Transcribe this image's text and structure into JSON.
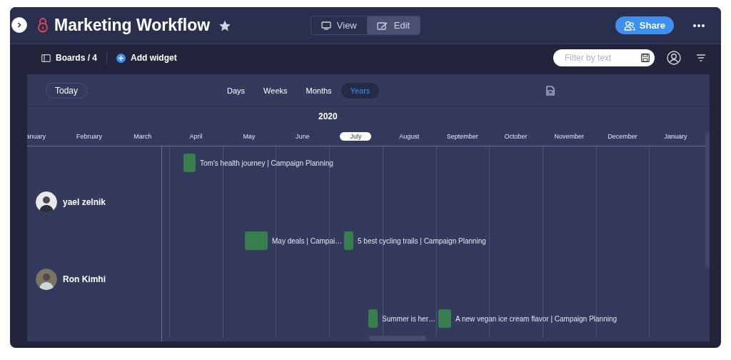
{
  "header": {
    "title": "Marketing Workflow",
    "view_modes": [
      {
        "label": "View",
        "kind": "view",
        "selected": false
      },
      {
        "label": "Edit",
        "kind": "edit",
        "selected": true
      }
    ],
    "share": "Share"
  },
  "toolbar": {
    "boards": "Boards / 4",
    "add_widget": "Add widget",
    "filter": {
      "placeholder": "Filter by text"
    }
  },
  "timeline": {
    "today": "Today",
    "scales": [
      {
        "label": "Days",
        "selected": false
      },
      {
        "label": "Weeks",
        "selected": false
      },
      {
        "label": "Months",
        "selected": false
      },
      {
        "label": "Years",
        "selected": true
      }
    ],
    "year": "2020",
    "months": [
      {
        "label": "anuary",
        "selected": false
      },
      {
        "label": "February",
        "selected": false
      },
      {
        "label": "March",
        "selected": false
      },
      {
        "label": "April",
        "selected": false
      },
      {
        "label": "May",
        "selected": false
      },
      {
        "label": "June",
        "selected": false
      },
      {
        "label": "July",
        "selected": true
      },
      {
        "label": "August",
        "selected": false
      },
      {
        "label": "September",
        "selected": false
      },
      {
        "label": "October",
        "selected": false
      },
      {
        "label": "November",
        "selected": false
      },
      {
        "label": "December",
        "selected": false
      },
      {
        "label": "January",
        "selected": false
      }
    ],
    "people": [
      {
        "name": "yael zelnik"
      },
      {
        "name": "Ron Kimhi"
      }
    ],
    "items": [
      {
        "label": "Tom's health journey | Campaign Planning"
      },
      {
        "label": "May deals | Campai…"
      },
      {
        "label": "5 best cycling trails | Campaign Planning"
      },
      {
        "label": "Summer is her…"
      },
      {
        "label": "A new vegan ice cream flavor | Campaign Planning"
      }
    ]
  }
}
